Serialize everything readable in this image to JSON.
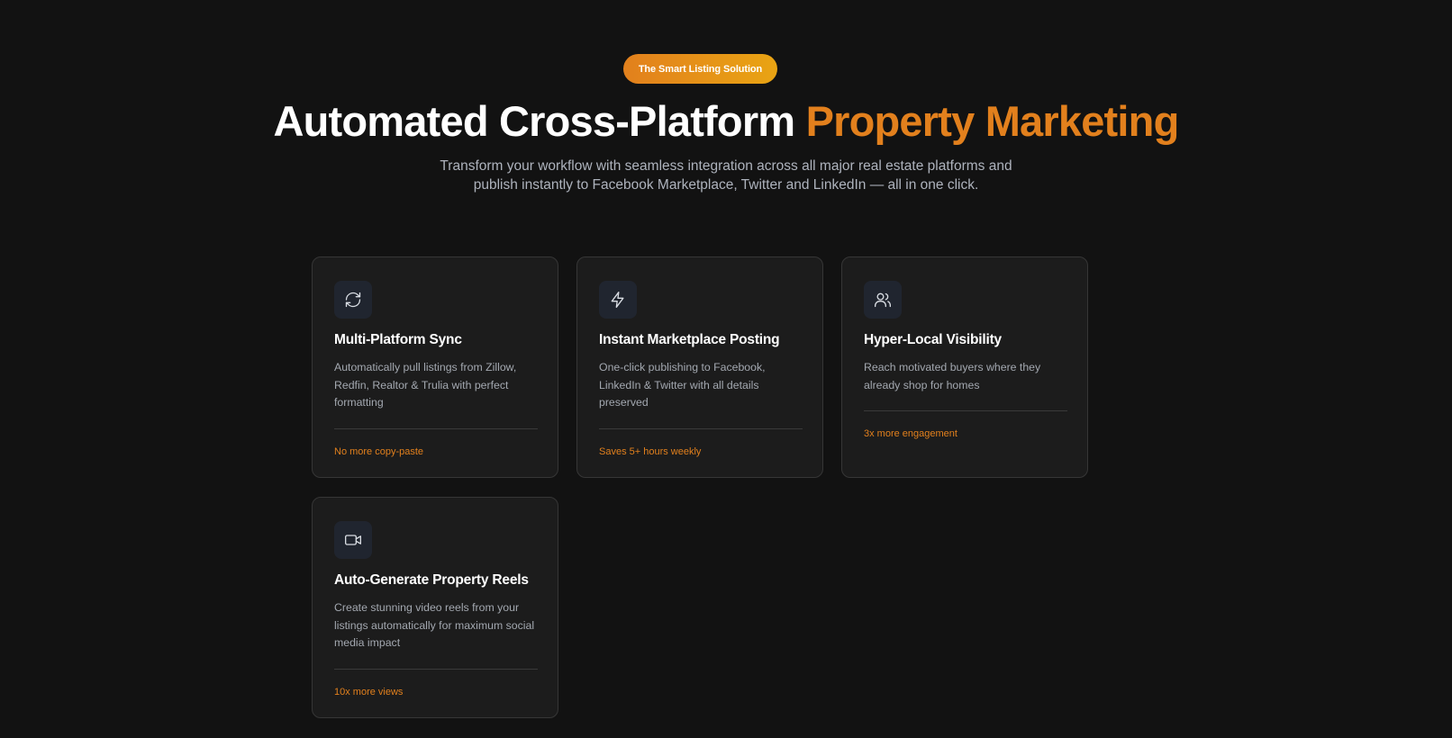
{
  "hero": {
    "badge": "The Smart Listing Solution",
    "headline_main": "Automated Cross-Platform",
    "headline_accent": "Property Marketing",
    "subtitle": "Transform your workflow with seamless integration across all major real estate platforms and publish instantly to Facebook Marketplace, Twitter and LinkedIn — all in one click."
  },
  "features": [
    {
      "icon": "refresh-icon",
      "title": "Multi-Platform Sync",
      "description": "Automatically pull listings from Zillow, Redfin, Realtor & Trulia with perfect formatting",
      "highlight": "No more copy-paste"
    },
    {
      "icon": "lightning-icon",
      "title": "Instant Marketplace Posting",
      "description": "One-click publishing to Facebook, LinkedIn & Twitter with all details preserved",
      "highlight": "Saves 5+ hours weekly"
    },
    {
      "icon": "users-icon",
      "title": "Hyper-Local Visibility",
      "description": "Reach motivated buyers where they already shop for homes",
      "highlight": "3x more engagement"
    },
    {
      "icon": "video-icon",
      "title": "Auto-Generate Property Reels",
      "description": "Create stunning video reels from your listings automatically for maximum social media impact",
      "highlight": "10x more views"
    }
  ],
  "colors": {
    "background": "#121212",
    "card": "#1c1c1c",
    "accent": "#e2801d",
    "accent_gradient_end": "#e9a413"
  }
}
